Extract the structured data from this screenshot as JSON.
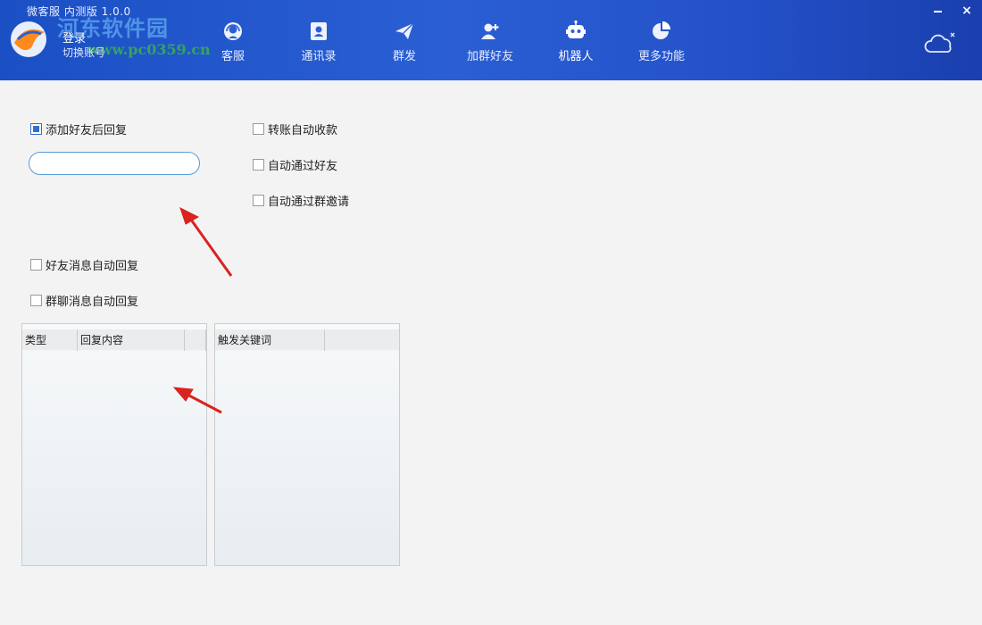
{
  "window": {
    "title": "微客服 内测版 1.0.0",
    "watermark": "河东软件园",
    "watermark_url": "www.pc0359.cn",
    "close_glyph": "×"
  },
  "account": {
    "login": "登录",
    "switch": "切换账号"
  },
  "nav": {
    "items": [
      {
        "label": "客服",
        "icon": "headset-icon"
      },
      {
        "label": "通讯录",
        "icon": "contacts-icon"
      },
      {
        "label": "群发",
        "icon": "paper-plane-icon"
      },
      {
        "label": "加群好友",
        "icon": "add-friend-icon"
      },
      {
        "label": "机器人",
        "icon": "robot-icon",
        "active": true
      },
      {
        "label": "更多功能",
        "icon": "pie-chart-icon"
      }
    ]
  },
  "settings": {
    "add_friend_reply": {
      "label": "添加好友后回复",
      "checked": true
    },
    "reply_input": {
      "value": ""
    },
    "transfer_auto_collect": {
      "label": "转账自动收款",
      "checked": false
    },
    "auto_accept_friend": {
      "label": "自动通过好友",
      "checked": false
    },
    "auto_accept_group": {
      "label": "自动通过群邀请",
      "checked": false
    },
    "friend_msg_auto_reply": {
      "label": "好友消息自动回复",
      "checked": false
    },
    "group_msg_auto_reply": {
      "label": "群聊消息自动回复",
      "checked": false
    }
  },
  "reply_table": {
    "columns": [
      "类型",
      "回复内容",
      ""
    ],
    "rows": []
  },
  "keyword_table": {
    "columns": [
      "触发关键词",
      ""
    ],
    "rows": []
  },
  "colors": {
    "header": "#2a5fd3",
    "accent": "#2f6fd1",
    "annotation_arrow": "#d9231f"
  }
}
